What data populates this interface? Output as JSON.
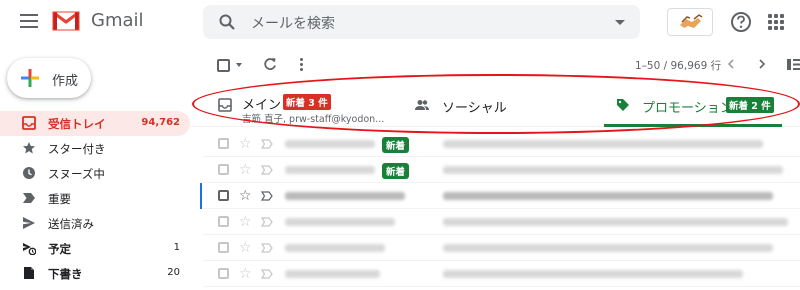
{
  "header": {
    "brand": "Gmail",
    "search_placeholder": "メールを検索"
  },
  "compose": {
    "label": "作成"
  },
  "sidebar": {
    "items": [
      {
        "label": "受信トレイ",
        "count": "94,762",
        "icon": "inbox-icon"
      },
      {
        "label": "スター付き",
        "count": "",
        "icon": "star-icon"
      },
      {
        "label": "スヌーズ中",
        "count": "",
        "icon": "clock-icon"
      },
      {
        "label": "重要",
        "count": "",
        "icon": "important-icon"
      },
      {
        "label": "送信済み",
        "count": "",
        "icon": "send-icon"
      },
      {
        "label": "予定",
        "count": "1",
        "icon": "scheduled-icon"
      },
      {
        "label": "下書き",
        "count": "20",
        "icon": "draft-icon"
      }
    ]
  },
  "toolbar": {
    "range": "1–50 / 96,969 行"
  },
  "tabs": {
    "main": {
      "label": "メイン",
      "badge": "新着 3 件",
      "snippet": "吉筋 直子, prw-staff@kyodon..."
    },
    "social": {
      "label": "ソーシャル"
    },
    "promotions": {
      "label": "プロモーション",
      "badge": "新着 2 件"
    }
  },
  "messages": [
    {
      "new_badge": "新着"
    },
    {
      "new_badge": "新着"
    },
    {
      "new_badge": ""
    },
    {
      "new_badge": ""
    },
    {
      "new_badge": ""
    },
    {
      "new_badge": ""
    }
  ],
  "colors": {
    "accent_red": "#d93025",
    "promo_green": "#188038",
    "annotation_red": "#e4161a",
    "focus_blue": "#1a73e8"
  }
}
